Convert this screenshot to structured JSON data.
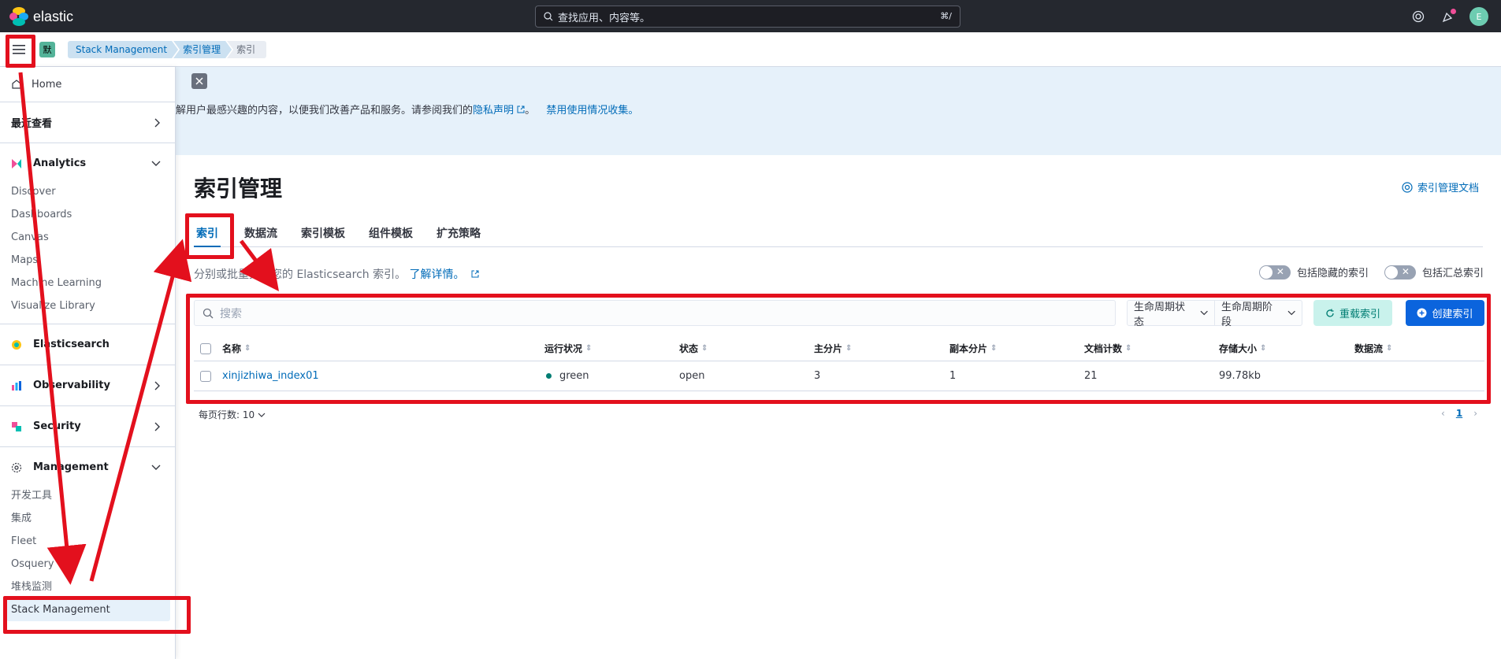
{
  "topbar": {
    "brand": "elastic",
    "search_placeholder": "查找应用、内容等。",
    "search_shortcut": "⌘/",
    "avatar_initial": "E"
  },
  "breadcrumbs": {
    "space": "默",
    "items": [
      "Stack Management",
      "索引管理",
      "索引"
    ]
  },
  "sidebar": {
    "home": "Home",
    "recent": "最近查看",
    "groups": [
      {
        "label": "Analytics",
        "expanded": true,
        "items": [
          "Discover",
          "Dashboards",
          "Canvas",
          "Maps",
          "Machine Learning",
          "Visualize Library"
        ]
      },
      {
        "label": "Elasticsearch",
        "expanded": false
      },
      {
        "label": "Observability",
        "expanded": false
      },
      {
        "label": "Security",
        "expanded": false
      },
      {
        "label": "Management",
        "expanded": true,
        "items": [
          "开发工具",
          "集成",
          "Fleet",
          "Osquery",
          "堆栈监测",
          "Stack Management"
        ]
      }
    ]
  },
  "callout": {
    "text": "解用户最感兴趣的内容，以便我们改善产品和服务。请参阅我们的",
    "privacy_link": "隐私声明",
    "sep": "。",
    "disable_link": "禁用使用情况收集。"
  },
  "main": {
    "title": "索引管理",
    "docs_link": "索引管理文档",
    "tabs": [
      "索引",
      "数据流",
      "索引模板",
      "组件模板",
      "扩充策略"
    ],
    "description": "分别或批量更新您的 Elasticsearch 索引。",
    "learn_more": "了解详情。",
    "toggle_hidden": "包括隐藏的索引",
    "toggle_rollup": "包括汇总索引",
    "search_placeholder": "搜索",
    "filter_lifecycle_status": "生命周期状态",
    "filter_lifecycle_phase": "生命周期阶段",
    "reload_button": "重载索引",
    "create_button": "创建索引",
    "columns": [
      "名称",
      "运行状况",
      "状态",
      "主分片",
      "副本分片",
      "文档计数",
      "存储大小",
      "数据流"
    ],
    "rows": [
      {
        "name": "xinjizhiwa_index01",
        "health": "green",
        "status": "open",
        "primary": "3",
        "replica": "1",
        "docs": "21",
        "size": "99.78kb",
        "datastream": ""
      }
    ],
    "rows_per_page": "每页行数: 10",
    "current_page": "1"
  },
  "colors": {
    "accent": "#006bb8",
    "annotation": "#e3101d",
    "health_green": "#017d73"
  }
}
